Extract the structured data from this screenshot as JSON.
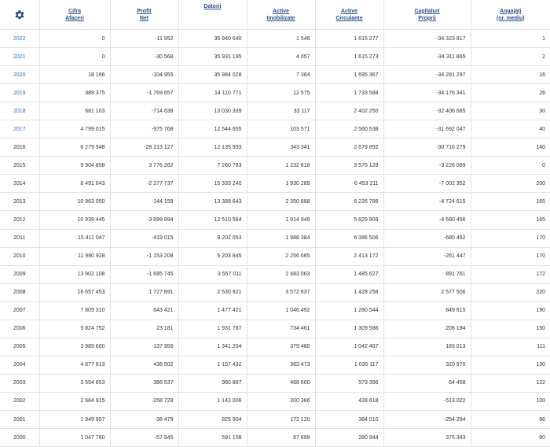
{
  "header": {
    "cifra": [
      "Cifra",
      "Afaceri"
    ],
    "profit": [
      "Profit",
      "Net"
    ],
    "datorii": "Datorii",
    "imobilizate": [
      "Active",
      "Imobilizate"
    ],
    "circulante": [
      "Active",
      "Circulante"
    ],
    "capitaluri": [
      "Capitaluri",
      "Proprii"
    ],
    "angajati": [
      "Angajați",
      "(nr. mediu)"
    ],
    "gear_icon": "gear-icon",
    "accent_color": "#2a4f85"
  },
  "rows": [
    {
      "year": "2022",
      "link": true,
      "cifra": "0",
      "profit": "-11 952",
      "datorii": "35 940 640",
      "imob": "1 546",
      "circ": "1 615 277",
      "cap": "-34 323 817",
      "ang": "1"
    },
    {
      "year": "2021",
      "link": true,
      "cifra": "0",
      "profit": "-30 568",
      "datorii": "35 931 195",
      "imob": "4 057",
      "circ": "1 615 273",
      "cap": "-34 311 865",
      "ang": "2"
    },
    {
      "year": "2020",
      "link": true,
      "cifra": "18 166",
      "profit": "-104 955",
      "datorii": "35 984 028",
      "imob": "7 364",
      "circ": "1 695 367",
      "cap": "-34 281 297",
      "ang": "16"
    },
    {
      "year": "2019",
      "link": true,
      "cifra": "389 375",
      "profit": "-1 769 657",
      "datorii": "14 110 771",
      "imob": "12 575",
      "circ": "1 733 588",
      "cap": "-34 176 341",
      "ang": "26"
    },
    {
      "year": "2018",
      "link": true,
      "cifra": "681 103",
      "profit": "-714 638",
      "datorii": "13 030 339",
      "imob": "33 117",
      "circ": "2 402 250",
      "cap": "-32 406 685",
      "ang": "30"
    },
    {
      "year": "2017",
      "link": true,
      "cifra": "4 799 015",
      "profit": "-975 768",
      "datorii": "12 544 655",
      "imob": "103 571",
      "circ": "2 560 538",
      "cap": "-31 692 047",
      "ang": "40"
    },
    {
      "year": "2016",
      "link": false,
      "cifra": "6 279 948",
      "profit": "-28 213 127",
      "datorii": "12 135 993",
      "imob": "343 341",
      "circ": "2 879 892",
      "cap": "-30 716 279",
      "ang": "140"
    },
    {
      "year": "2015",
      "link": false,
      "cifra": "9 904 858",
      "profit": "3 776 262",
      "datorii": "7 260 783",
      "imob": "1 232 618",
      "circ": "3 575 129",
      "cap": "-3 226 089",
      "ang": "0"
    },
    {
      "year": "2014",
      "link": false,
      "cifra": "8 491 643",
      "profit": "-2 277 737",
      "datorii": "15 333 240",
      "imob": "1 930 289",
      "circ": "6 453 211",
      "cap": "-7 002 352",
      "ang": "200"
    },
    {
      "year": "2013",
      "link": false,
      "cifra": "10 963 050",
      "profit": "-144 159",
      "datorii": "13 389 643",
      "imob": "2 350 888",
      "circ": "6 226 786",
      "cap": "-4 724 615",
      "ang": "165"
    },
    {
      "year": "2012",
      "link": false,
      "cifra": "10 939 445",
      "profit": "-3 899 994",
      "datorii": "12 510 584",
      "imob": "1 914 946",
      "circ": "5 829 909",
      "cap": "-4 580 456",
      "ang": "165"
    },
    {
      "year": "2011",
      "link": false,
      "cifra": "15 411 047",
      "profit": "-419 015",
      "datorii": "9 202 053",
      "imob": "1 988 384",
      "circ": "6 386 506",
      "cap": "-680 462",
      "ang": "170"
    },
    {
      "year": "2010",
      "link": false,
      "cifra": "11 990 928",
      "profit": "-1 153 208",
      "datorii": "5 203 845",
      "imob": "2 256 665",
      "circ": "2 413 172",
      "cap": "-261 447",
      "ang": "170"
    },
    {
      "year": "2009",
      "link": false,
      "cifra": "13 902 108",
      "profit": "-1 685 745",
      "datorii": "3 557 011",
      "imob": "2 883 063",
      "circ": "1 485 627",
      "cap": "891 761",
      "ang": "172"
    },
    {
      "year": "2008",
      "link": false,
      "cifra": "16 657 453",
      "profit": "1 727 891",
      "datorii": "2 530 921",
      "imob": "3 572 637",
      "circ": "1 428 258",
      "cap": "2 577 506",
      "ang": "220"
    },
    {
      "year": "2007",
      "link": false,
      "cifra": "7 809 310",
      "profit": "643 421",
      "datorii": "1 477 421",
      "imob": "1 046 492",
      "circ": "1 280 544",
      "cap": "849 615",
      "ang": "190"
    },
    {
      "year": "2006",
      "link": false,
      "cifra": "5 824 752",
      "profit": "23 181",
      "datorii": "1 931 787",
      "imob": "734 461",
      "circ": "1 309 586",
      "cap": "206 194",
      "ang": "150"
    },
    {
      "year": "2005",
      "link": false,
      "cifra": "3 989 600",
      "profit": "-137 956",
      "datorii": "1 341 204",
      "imob": "379 480",
      "circ": "1 042 487",
      "cap": "183 013",
      "ang": "111"
    },
    {
      "year": "2004",
      "link": false,
      "cifra": "4 877 813",
      "profit": "436 502",
      "datorii": "1 157 432",
      "imob": "363 473",
      "circ": "1 035 117",
      "cap": "320 970",
      "ang": "130"
    },
    {
      "year": "2003",
      "link": false,
      "cifra": "3 554 853",
      "profit": "386 537",
      "datorii": "980 887",
      "imob": "468 600",
      "circ": "573 396",
      "cap": "64 468",
      "ang": "122"
    },
    {
      "year": "2002",
      "link": false,
      "cifra": "2 684 915",
      "profit": "-258 728",
      "datorii": "1 142 006",
      "imob": "200 366",
      "circ": "428 618",
      "cap": "-513 022",
      "ang": "100"
    },
    {
      "year": "2001",
      "link": false,
      "cifra": "1 949 957",
      "profit": "-38 479",
      "datorii": "825 904",
      "imob": "172 120",
      "circ": "384 010",
      "cap": "-254 294",
      "ang": "86"
    },
    {
      "year": "2000",
      "link": false,
      "cifra": "1 047 760",
      "profit": "-57 945",
      "datorii": "591 158",
      "imob": "87 699",
      "circ": "280 944",
      "cap": "375 343",
      "ang": "80"
    }
  ]
}
